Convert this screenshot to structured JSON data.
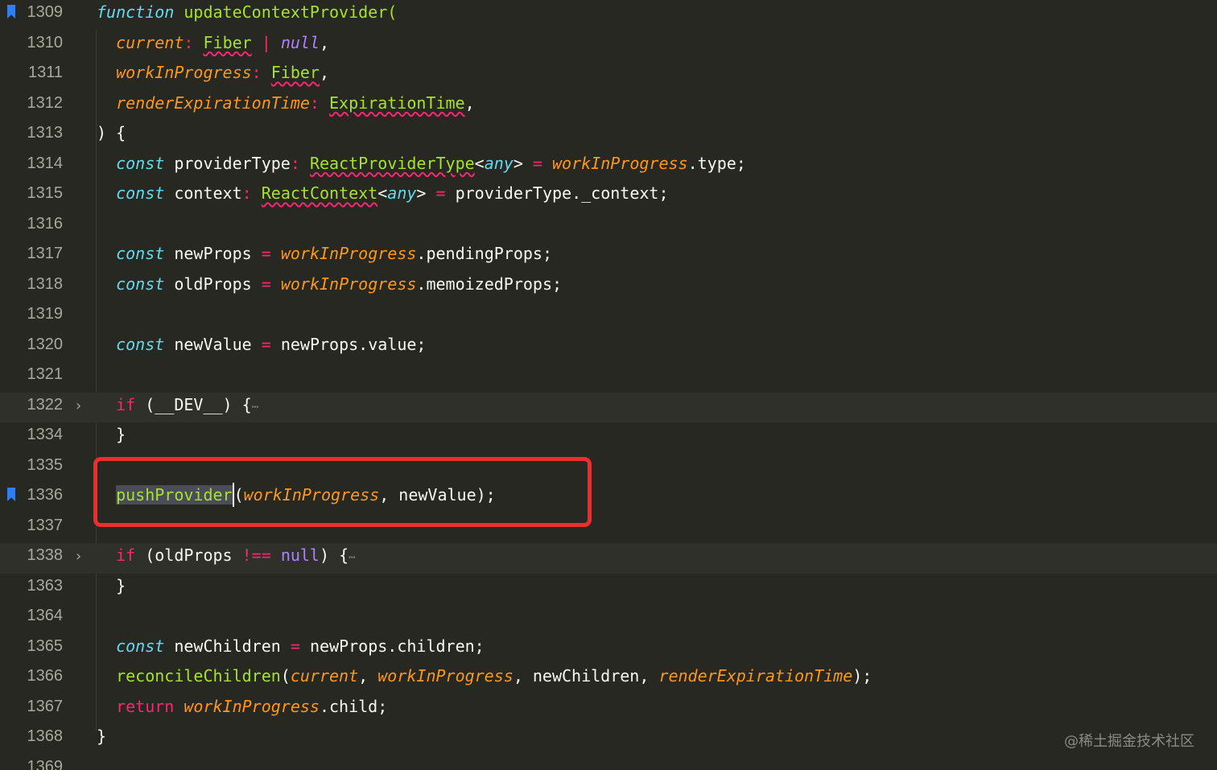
{
  "editor": {
    "watermark": "@稀土掘金技术社区"
  },
  "lines": [
    {
      "no": "1309",
      "bookmark": true
    },
    {
      "no": "1310"
    },
    {
      "no": "1311"
    },
    {
      "no": "1312"
    },
    {
      "no": "1313"
    },
    {
      "no": "1314"
    },
    {
      "no": "1315"
    },
    {
      "no": "1316"
    },
    {
      "no": "1317"
    },
    {
      "no": "1318"
    },
    {
      "no": "1319"
    },
    {
      "no": "1320"
    },
    {
      "no": "1321"
    },
    {
      "no": "1322",
      "folded": true
    },
    {
      "no": "1334"
    },
    {
      "no": "1335"
    },
    {
      "no": "1336",
      "bookmark": true
    },
    {
      "no": "1337"
    },
    {
      "no": "1338",
      "folded": true
    },
    {
      "no": "1363"
    },
    {
      "no": "1364"
    },
    {
      "no": "1365"
    },
    {
      "no": "1366"
    },
    {
      "no": "1367"
    },
    {
      "no": "1368"
    },
    {
      "no": "1369"
    }
  ],
  "code": {
    "l1309": {
      "kw": "function",
      "name": " updateContextProvider("
    },
    "l1310": {
      "param": "current",
      "colon": ":",
      "type": "Fiber",
      "pipe": " |",
      "nullv": "null",
      "end": ","
    },
    "l1311": {
      "param": "workInProgress",
      "colon": ":",
      "type": "Fiber",
      "end": ","
    },
    "l1312": {
      "param": "renderExpirationTime",
      "colon": ":",
      "type": "ExpirationTime",
      "end": ","
    },
    "l1313": {
      "text": ") {"
    },
    "l1314": {
      "kw": "const",
      "var": " providerType",
      "colon": ":",
      "type": "ReactProviderType",
      "generic_open": "<",
      "generic": "any",
      "generic_close": ">",
      "eq": " =",
      "obj": "workInProgress",
      "rest": ".type;"
    },
    "l1315": {
      "kw": "const",
      "var": " context",
      "colon": ":",
      "type": "ReactContext",
      "generic_open": "<",
      "generic": "any",
      "generic_close": ">",
      "eq": " =",
      "rest": " providerType._context;"
    },
    "l1317": {
      "kw": "const",
      "var": " newProps",
      "eq": " =",
      "obj": "workInProgress",
      "rest": ".pendingProps;"
    },
    "l1318": {
      "kw": "const",
      "var": " oldProps",
      "eq": " =",
      "obj": "workInProgress",
      "rest": ".memoizedProps;"
    },
    "l1320": {
      "kw": "const",
      "var": " newValue",
      "eq": " =",
      "rest": " newProps.value;"
    },
    "l1322": {
      "kw": "if",
      "rest": " (__DEV__) {",
      "ellipsis": "⋯"
    },
    "l1334": {
      "text": "}"
    },
    "l1336": {
      "fn": "pushProvider",
      "open": "(",
      "arg1": "workInProgress",
      "rest": ", newValue);"
    },
    "l1338": {
      "kw": "if",
      "open": " (oldProps ",
      "op": "!==",
      "nullv": "null",
      "rest": ") {",
      "ellipsis": "⋯"
    },
    "l1363": {
      "text": "}"
    },
    "l1365": {
      "kw": "const",
      "var": " newChildren",
      "eq": " =",
      "rest": " newProps.children;"
    },
    "l1366": {
      "fn": "reconcileChildren",
      "open": "(",
      "arg1": "current",
      "sep1": ", ",
      "arg2": "workInProgress",
      "sep2": ", newChildren, ",
      "arg3": "renderExpirationTime",
      "rest": ");"
    },
    "l1367": {
      "kw": "return",
      "obj": "workInProgress",
      "rest": ".child;"
    },
    "l1368": {
      "text": "}"
    }
  }
}
